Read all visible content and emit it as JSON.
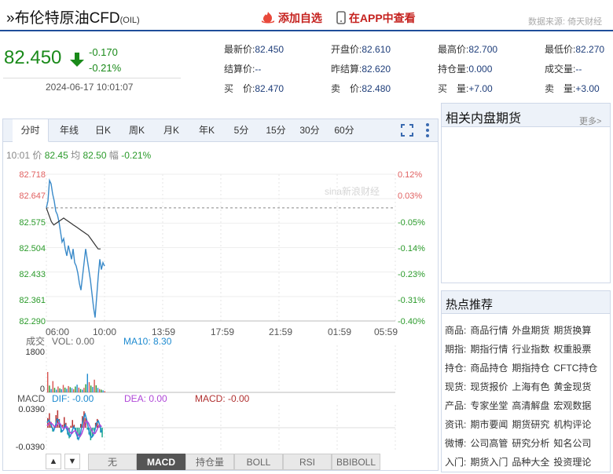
{
  "header": {
    "title": "布伦特原油CFD",
    "code": "(OIL)",
    "add_watch": "添加自选",
    "app_view": "在APP中查看",
    "source": "数据来源: 倚天财经"
  },
  "price": {
    "last": "82.450",
    "change": "-0.170",
    "change_pct": "-0.21%",
    "time": "2024-06-17 10:01:07"
  },
  "quotes": {
    "row1": [
      {
        "label": "最新价:",
        "value": "82.450"
      },
      {
        "label": "开盘价:",
        "value": "82.610"
      },
      {
        "label": "最高价:",
        "value": "82.700"
      },
      {
        "label": "最低价:",
        "value": "82.270"
      }
    ],
    "row2": [
      {
        "label": "结算价:",
        "value": "--"
      },
      {
        "label": "昨结算:",
        "value": "82.620"
      },
      {
        "label": "持仓量:",
        "value": "0.000"
      },
      {
        "label": "成交量:",
        "value": "--"
      }
    ],
    "row3": [
      {
        "label": "买　价:",
        "value": "82.470"
      },
      {
        "label": "卖　价:",
        "value": "82.480"
      },
      {
        "label": "买　量:",
        "value": "+7.00"
      },
      {
        "label": "卖　量:",
        "value": "+3.00"
      }
    ]
  },
  "chart_tabs": [
    "分时",
    "年线",
    "日K",
    "周K",
    "月K",
    "年K",
    "5分",
    "15分",
    "30分",
    "60分"
  ],
  "info_line": {
    "time": "10:01",
    "price_label": "价",
    "price": "82.45",
    "avg_label": "均",
    "avg": "82.50",
    "amp_label": "幅",
    "amp": "-0.21%"
  },
  "watermark": "sina新浪财经",
  "chart_data": {
    "type": "line",
    "y_ticks": [
      "82.718",
      "82.647",
      "82.575",
      "82.504",
      "82.433",
      "82.361",
      "82.290"
    ],
    "pct_ticks": [
      "0.12%",
      "0.03%",
      "-0.05%",
      "-0.14%",
      "-0.23%",
      "-0.31%",
      "-0.40%"
    ],
    "x_ticks": [
      "06:00",
      "10:00",
      "13:59",
      "17:59",
      "21:59",
      "01:59",
      "05:59"
    ],
    "ylim": [
      82.29,
      82.718
    ],
    "prev_settle": 82.62,
    "price_series": [
      82.62,
      82.64,
      82.7,
      82.69,
      82.66,
      82.64,
      82.61,
      82.6,
      82.58,
      82.55,
      82.52,
      82.53,
      82.5,
      82.48,
      82.51,
      82.49,
      82.47,
      82.5,
      82.46,
      82.45,
      82.43,
      82.4,
      82.38,
      82.42,
      82.46,
      82.5,
      82.47,
      82.44,
      82.41,
      82.37,
      82.33,
      82.3,
      82.36,
      82.42,
      82.47,
      82.44,
      82.46,
      82.45
    ],
    "avg_series": [
      82.62,
      82.6,
      82.58,
      82.57,
      82.575,
      82.58,
      82.585,
      82.59,
      82.585,
      82.58,
      82.575,
      82.57,
      82.565,
      82.56,
      82.555,
      82.55,
      82.545,
      82.54,
      82.53,
      82.52,
      82.51,
      82.5,
      82.5
    ],
    "volume": {
      "label": "成交",
      "vol_label": "VOL: 0.00",
      "ma10_label": "MA10: 8.30",
      "max_tick": "1800",
      "zero_tick": "0",
      "ymax": 1800,
      "bars": [
        900,
        300,
        150,
        500,
        200,
        120,
        260,
        180,
        140,
        330,
        210,
        160,
        280,
        230,
        190,
        140,
        260,
        340,
        210,
        150,
        120,
        200,
        360,
        820,
        450,
        300,
        240,
        560,
        310,
        200,
        150,
        120,
        90,
        60
      ]
    },
    "macd": {
      "label": "MACD",
      "dif_label": "DIF: -0.00",
      "dea_label": "DEA: 0.00",
      "macd_label": "MACD: -0.00",
      "top_tick": "0.0390",
      "bottom_tick": "-0.0390",
      "ylim": [
        -0.039,
        0.039
      ],
      "bars": [
        0.02,
        0.03,
        0.012,
        -0.008,
        0.004,
        0.026,
        0.036,
        0.018,
        -0.01,
        0.006,
        0.022,
        0.01,
        -0.014,
        -0.022,
        0.004,
        0.016,
        0.006,
        -0.012,
        -0.024,
        -0.016,
        0.008,
        0.024,
        0.034,
        0.02,
        -0.004,
        -0.014,
        -0.026,
        -0.018,
        -0.006,
        0.01,
        0.018,
        0.006,
        -0.01,
        -0.02
      ],
      "dif": [
        0.01,
        0.016,
        0.01,
        0.0,
        -0.006,
        0.004,
        0.018,
        0.016,
        0.002,
        -0.008,
        -0.004,
        0.006,
        -0.004,
        -0.016,
        -0.018,
        -0.008,
        0.002,
        -0.004,
        -0.016,
        -0.024,
        -0.016,
        0.004,
        0.02,
        0.028,
        0.016,
        -0.002,
        -0.016,
        -0.02,
        -0.016,
        -0.004,
        0.01,
        0.014,
        0.004,
        -0.01
      ],
      "dea": [
        0.004,
        0.008,
        0.01,
        0.008,
        0.004,
        0.002,
        0.006,
        0.01,
        0.008,
        0.002,
        -0.002,
        0.0,
        0.002,
        -0.004,
        -0.01,
        -0.012,
        -0.008,
        -0.006,
        -0.01,
        -0.016,
        -0.018,
        -0.012,
        -0.002,
        0.01,
        0.014,
        0.01,
        0.002,
        -0.006,
        -0.012,
        -0.012,
        -0.006,
        0.002,
        0.006,
        0.002
      ]
    }
  },
  "bottom_tabs": [
    "无",
    "MACD",
    "持仓量",
    "BOLL",
    "RSI",
    "BBIBOLL"
  ],
  "bottom_arrows": [
    "▲",
    "▼"
  ],
  "related": {
    "title": "相关内盘期货",
    "more": "更多>"
  },
  "hot": {
    "title": "热点推荐",
    "rows": [
      {
        "label": "商品:",
        "items": [
          "商品行情",
          "外盘期货",
          "期货换算"
        ]
      },
      {
        "label": "期指:",
        "items": [
          "期指行情",
          "行业指数",
          "权重股票"
        ]
      },
      {
        "label": "持仓:",
        "items": [
          "商品持仓",
          "期指持仓",
          "CFTC持仓"
        ]
      },
      {
        "label": "现货:",
        "items": [
          "现货报价",
          "上海有色",
          "黄金现货"
        ]
      },
      {
        "label": "产品:",
        "items": [
          "专家坐堂",
          "高清解盘",
          "宏观数据"
        ]
      },
      {
        "label": "资讯:",
        "items": [
          "期市要闻",
          "期货研究",
          "机构评论"
        ]
      },
      {
        "label": "微博:",
        "items": [
          "公司高管",
          "研究分析",
          "知名公司"
        ]
      },
      {
        "label": "入门:",
        "items": [
          "期货入门",
          "品种大全",
          "投资理论"
        ]
      }
    ]
  },
  "colors": {
    "accent": "#1f4e9a",
    "down": "#1a8a1a",
    "up": "#d9534f",
    "line": "#3a8ac9",
    "avg": "#333333",
    "dea": "#b048d8"
  }
}
